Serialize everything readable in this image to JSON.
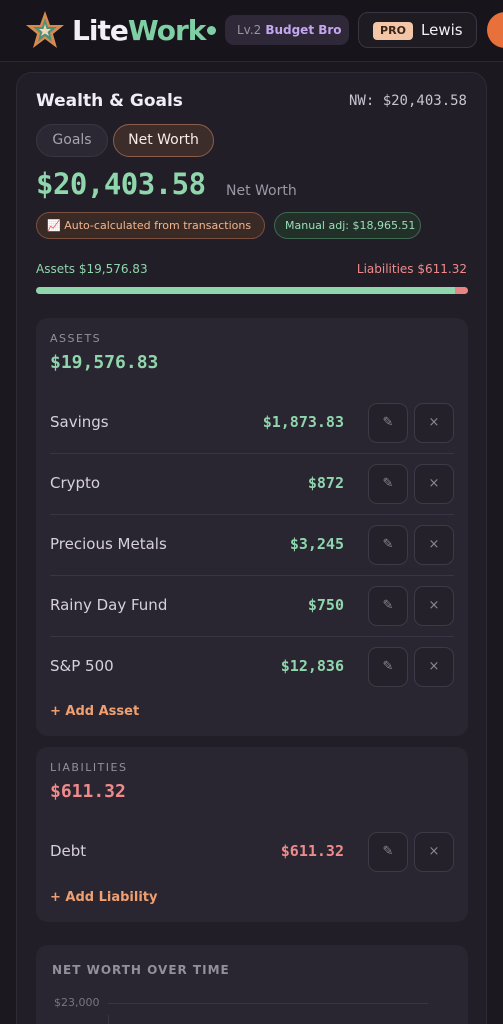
{
  "app": {
    "logo_lite": "Lite",
    "logo_work": "Work",
    "level": "Lv.2",
    "rank": "Budget Bro",
    "pro_badge": "PRO",
    "user_name": "Lewis"
  },
  "colors": {
    "accent_green": "#8fd6ad",
    "accent_orange": "#f0a070",
    "liability_red": "#ef8b8b",
    "background": "#1b1820"
  },
  "header": {
    "title": "Wealth & Goals",
    "nw_label": "NW: $20,403.58"
  },
  "tabs": [
    {
      "label": "Goals",
      "active": false
    },
    {
      "label": "Net Worth",
      "active": true
    }
  ],
  "summary": {
    "total": "$20,403.58",
    "total_label": "Net Worth",
    "auto_pill": "📈 Auto-calculated from transactions",
    "manual_pill": "Manual adj: $18,965.51",
    "assets_label": "Assets $19,576.83",
    "liabilities_label": "Liabilities $611.32",
    "assets_fraction": 0.97
  },
  "assets": {
    "label": "ASSETS",
    "total": "$19,576.83",
    "items": [
      {
        "name": "Savings",
        "value": "$1,873.83"
      },
      {
        "name": "Crypto",
        "value": "$872"
      },
      {
        "name": "Precious Metals",
        "value": "$3,245"
      },
      {
        "name": "Rainy Day Fund",
        "value": "$750"
      },
      {
        "name": "S&P 500",
        "value": "$12,836"
      }
    ],
    "add_label": "+ Add Asset"
  },
  "liabilities": {
    "label": "LIABILITIES",
    "total": "$611.32",
    "items": [
      {
        "name": "Debt",
        "value": "$611.32"
      }
    ],
    "add_label": "+ Add Liability"
  },
  "chart": {
    "title": "NET WORTH OVER TIME",
    "top_tick": "$23,000"
  },
  "icons": {
    "edit": "✎",
    "delete": "×",
    "logo": "star-logo-icon"
  }
}
